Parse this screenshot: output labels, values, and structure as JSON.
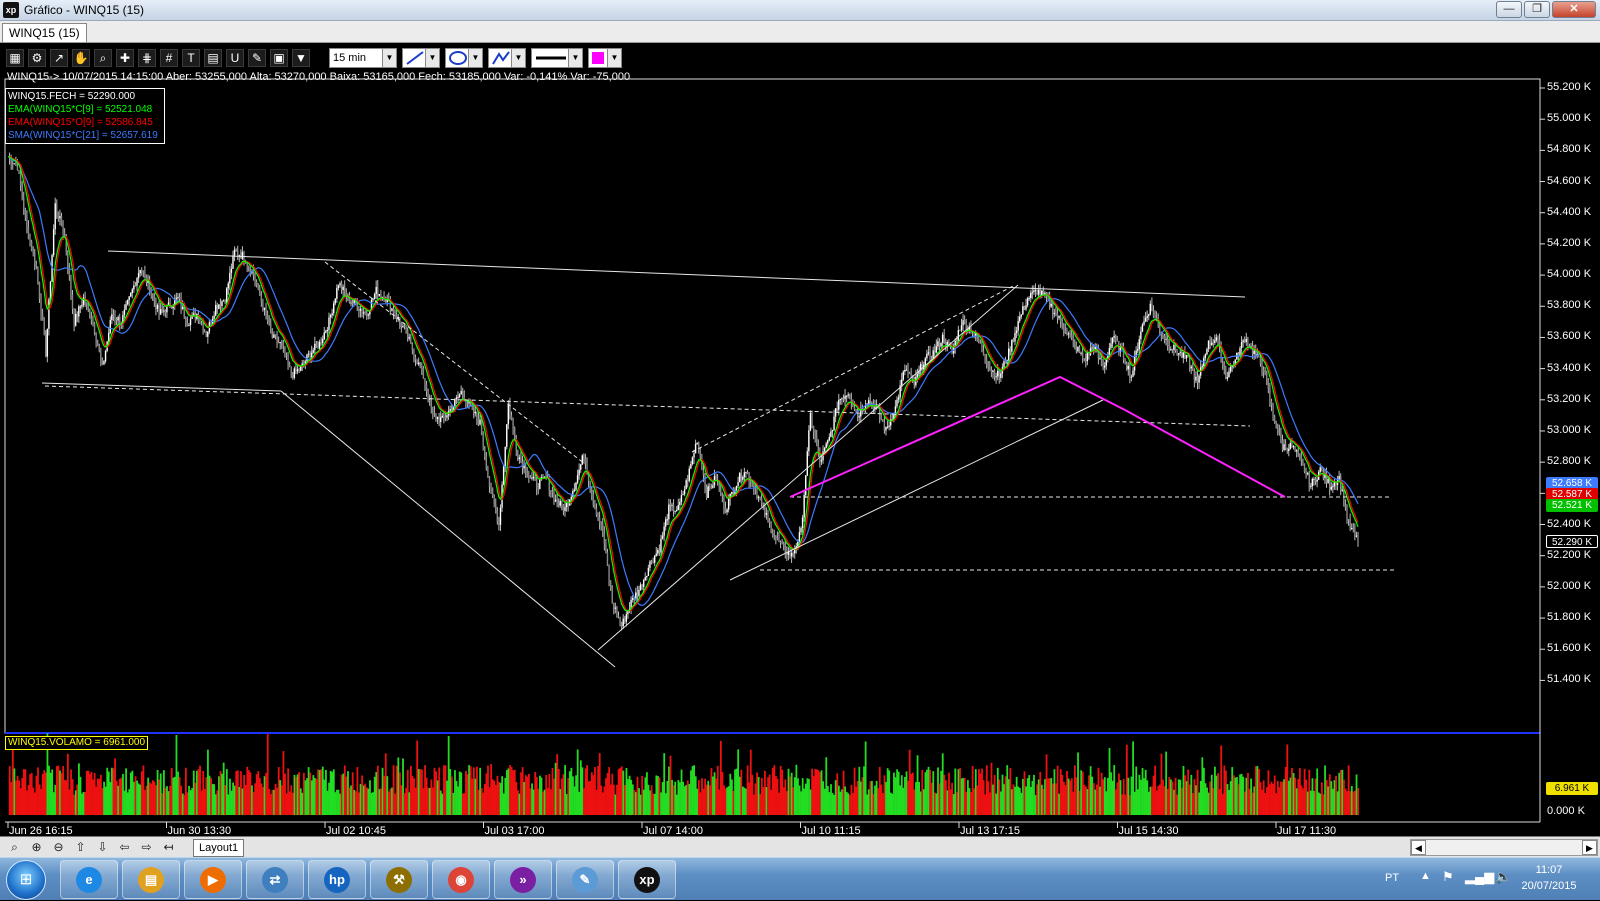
{
  "window": {
    "title": "Gráfico - WINQ15 (15)",
    "app_icon": "xp",
    "minimize": "—",
    "restore": "❐",
    "close": "✕"
  },
  "tab": {
    "label": "WINQ15 (15)"
  },
  "toolbar": {
    "timeframe": "15 min",
    "icons": [
      "chart-icon",
      "gear-icon",
      "trend-icon",
      "hand-icon",
      "zoom-icon",
      "crosshair-icon",
      "fib-icon",
      "grid-icon",
      "text-icon",
      "calc-icon",
      "magnet-icon",
      "brush-icon",
      "save-icon",
      "filter-icon"
    ],
    "glyphs": [
      "▦",
      "⚙",
      "↗",
      "✋",
      "⌕",
      "✚",
      "⋕",
      "#",
      "T",
      "▤",
      "U",
      "✎",
      "▣",
      "▼"
    ],
    "color": "#ff00ff"
  },
  "info": {
    "text": "WINQ15-> 10/07/2015 14:15:00 Aber: 53255,000 Alta: 53270,000 Baixa: 53165,000 Fech: 53185,000 Var: -0,141% Var: -75,000"
  },
  "legend": [
    {
      "text": "WINQ15.FECH = 52290.000",
      "color": "#ffffff"
    },
    {
      "text": "EMA(WINQ15*C[9] = 52521.048",
      "color": "#00ff00"
    },
    {
      "text": "EMA(WINQ15*O[9] = 52586.845",
      "color": "#ff0000"
    },
    {
      "text": "SMA(WINQ15*C[21] = 52657.619",
      "color": "#3d7bff"
    }
  ],
  "price_axis": {
    "labels": [
      "55.200 K",
      "55.000 K",
      "54.800 K",
      "54.600 K",
      "54.400 K",
      "54.200 K",
      "54.000 K",
      "53.800 K",
      "53.600 K",
      "53.400 K",
      "53.200 K",
      "53.000 K",
      "52.800 K",
      "52.600 K",
      "52.400 K",
      "52.200 K",
      "52.000 K",
      "51.800 K",
      "51.600 K",
      "51.400 K"
    ],
    "min": 51300,
    "max": 55200
  },
  "price_boxes": [
    {
      "text": "52.658 K",
      "value": 52658,
      "color": "#3d7bff"
    },
    {
      "text": "52.587 K",
      "value": 52587,
      "color": "#e00000"
    },
    {
      "text": "52.521 K",
      "value": 52521,
      "color": "#00c000"
    },
    {
      "text": "52.290 K",
      "value": 52290,
      "color": "#000000"
    }
  ],
  "volume": {
    "label": "WINQ15.VOLAMO = 6961.000",
    "axis": [
      "6.961 K",
      "0.000 K"
    ]
  },
  "time_axis": [
    "Jun 26 16:15",
    "Jun 30 13:30",
    "Jul 02 10:45",
    "Jul 03 17:00",
    "Jul 07 14:00",
    "Jul 10 11:15",
    "Jul 13 17:15",
    "Jul 15 14:30",
    "Jul 17 11:30"
  ],
  "navbar": {
    "layout_tab": "Layout1",
    "icons": [
      "zoom-icon",
      "zoom-in-icon",
      "zoom-out-icon",
      "arrow-up-icon",
      "arrow-down-icon",
      "arrow-left-icon",
      "arrow-right-icon",
      "arrow-first-icon"
    ],
    "glyphs": [
      "⌕",
      "⊕",
      "⊖",
      "⇧",
      "⇩",
      "⇦",
      "⇨",
      "↤"
    ]
  },
  "taskbar": {
    "start": "⊞",
    "apps": [
      {
        "name": "ie-icon",
        "glyph": "e",
        "color": "#1e88e5"
      },
      {
        "name": "explorer-icon",
        "glyph": "▤",
        "color": "#e0a020"
      },
      {
        "name": "media-icon",
        "glyph": "▶",
        "color": "#ef6c00"
      },
      {
        "name": "network-icon",
        "glyph": "⇄",
        "color": "#3f7fbf"
      },
      {
        "name": "hp-icon",
        "glyph": "hp",
        "color": "#1565c0"
      },
      {
        "name": "tools-icon",
        "glyph": "⚒",
        "color": "#8d6e00"
      },
      {
        "name": "chrome-icon",
        "glyph": "◉",
        "color": "#db4437"
      },
      {
        "name": "app-icon",
        "glyph": "»",
        "color": "#7b1fa2"
      },
      {
        "name": "paint-icon",
        "glyph": "✎",
        "color": "#5c9bd5"
      },
      {
        "name": "xp-icon",
        "glyph": "xp",
        "color": "#111111"
      }
    ],
    "lang": "PT",
    "time": "11:07",
    "date": "20/07/2015"
  },
  "chart_data": {
    "type": "candlestick",
    "ylim": [
      51300,
      55200
    ],
    "close_path": [
      [
        0,
        54760
      ],
      [
        6,
        54700
      ],
      [
        12,
        54300
      ],
      [
        18,
        54050
      ],
      [
        24,
        53500
      ],
      [
        30,
        54450
      ],
      [
        36,
        54250
      ],
      [
        42,
        53700
      ],
      [
        48,
        53850
      ],
      [
        54,
        53700
      ],
      [
        60,
        53400
      ],
      [
        66,
        53750
      ],
      [
        72,
        53700
      ],
      [
        78,
        53870
      ],
      [
        84,
        54050
      ],
      [
        90,
        53920
      ],
      [
        96,
        53750
      ],
      [
        102,
        53800
      ],
      [
        108,
        53850
      ],
      [
        114,
        53700
      ],
      [
        120,
        53750
      ],
      [
        126,
        53620
      ],
      [
        132,
        53800
      ],
      [
        138,
        53850
      ],
      [
        144,
        54150
      ],
      [
        150,
        54120
      ],
      [
        156,
        54000
      ],
      [
        162,
        53800
      ],
      [
        168,
        53600
      ],
      [
        174,
        53550
      ],
      [
        180,
        53360
      ],
      [
        186,
        53400
      ],
      [
        192,
        53500
      ],
      [
        198,
        53560
      ],
      [
        204,
        53700
      ],
      [
        210,
        53950
      ],
      [
        216,
        53850
      ],
      [
        222,
        53800
      ],
      [
        228,
        53750
      ],
      [
        234,
        53900
      ],
      [
        240,
        53850
      ],
      [
        246,
        53750
      ],
      [
        252,
        53650
      ],
      [
        258,
        53500
      ],
      [
        264,
        53350
      ],
      [
        270,
        53100
      ],
      [
        276,
        53070
      ],
      [
        282,
        53150
      ],
      [
        288,
        53250
      ],
      [
        294,
        53150
      ],
      [
        300,
        53050
      ],
      [
        306,
        52650
      ],
      [
        312,
        52400
      ],
      [
        318,
        53170
      ],
      [
        324,
        52850
      ],
      [
        330,
        52730
      ],
      [
        336,
        52650
      ],
      [
        342,
        52700
      ],
      [
        348,
        52550
      ],
      [
        354,
        52500
      ],
      [
        360,
        52650
      ],
      [
        366,
        52850
      ],
      [
        372,
        52550
      ],
      [
        378,
        52350
      ],
      [
        384,
        51900
      ],
      [
        390,
        51750
      ],
      [
        396,
        51900
      ],
      [
        402,
        52000
      ],
      [
        408,
        52150
      ],
      [
        414,
        52250
      ],
      [
        420,
        52500
      ],
      [
        426,
        52500
      ],
      [
        432,
        52700
      ],
      [
        438,
        52950
      ],
      [
        444,
        52600
      ],
      [
        450,
        52700
      ],
      [
        456,
        52500
      ],
      [
        462,
        52650
      ],
      [
        468,
        52750
      ],
      [
        474,
        52650
      ],
      [
        480,
        52500
      ],
      [
        486,
        52350
      ],
      [
        492,
        52250
      ],
      [
        498,
        52200
      ],
      [
        504,
        52350
      ],
      [
        510,
        53100
      ],
      [
        516,
        52800
      ],
      [
        522,
        52950
      ],
      [
        528,
        53200
      ],
      [
        534,
        53250
      ],
      [
        540,
        53100
      ],
      [
        546,
        53200
      ],
      [
        552,
        53150
      ],
      [
        558,
        53000
      ],
      [
        564,
        53150
      ],
      [
        570,
        53400
      ],
      [
        576,
        53300
      ],
      [
        582,
        53450
      ],
      [
        588,
        53500
      ],
      [
        594,
        53600
      ],
      [
        600,
        53500
      ],
      [
        606,
        53700
      ],
      [
        612,
        53650
      ],
      [
        618,
        53550
      ],
      [
        624,
        53400
      ],
      [
        630,
        53350
      ],
      [
        636,
        53500
      ],
      [
        642,
        53700
      ],
      [
        648,
        53850
      ],
      [
        654,
        53900
      ],
      [
        660,
        53850
      ],
      [
        666,
        53750
      ],
      [
        672,
        53650
      ],
      [
        678,
        53550
      ],
      [
        684,
        53450
      ],
      [
        690,
        53550
      ],
      [
        696,
        53400
      ],
      [
        702,
        53600
      ],
      [
        708,
        53500
      ],
      [
        714,
        53350
      ],
      [
        720,
        53650
      ],
      [
        726,
        53800
      ],
      [
        732,
        53650
      ],
      [
        738,
        53550
      ],
      [
        744,
        53500
      ],
      [
        750,
        53450
      ],
      [
        756,
        53300
      ],
      [
        762,
        53550
      ],
      [
        768,
        53600
      ],
      [
        774,
        53350
      ],
      [
        780,
        53450
      ],
      [
        786,
        53600
      ],
      [
        792,
        53500
      ],
      [
        798,
        53400
      ],
      [
        804,
        53100
      ],
      [
        810,
        52900
      ],
      [
        816,
        52900
      ],
      [
        822,
        52800
      ],
      [
        828,
        52650
      ],
      [
        834,
        52750
      ],
      [
        840,
        52650
      ],
      [
        846,
        52700
      ],
      [
        852,
        52400
      ],
      [
        858,
        52290
      ]
    ],
    "ema9_close_last": 52521.048,
    "ema9_open_last": 52586.845,
    "sma21_last": 52657.619
  }
}
